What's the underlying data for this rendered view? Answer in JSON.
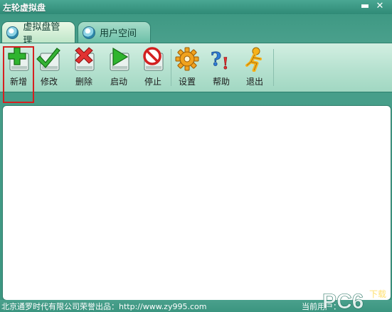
{
  "window": {
    "title": "左轮虚拟盘",
    "minimize_glyph": "▬",
    "close_glyph": "✕"
  },
  "tabs": [
    {
      "label": "虚拟盘管理",
      "icon": "disk-icon",
      "active": true
    },
    {
      "label": "用户空间",
      "icon": "disk-icon",
      "active": false
    }
  ],
  "toolbar": {
    "new_label": "新增",
    "edit_label": "修改",
    "delete_label": "删除",
    "start_label": "启动",
    "stop_label": "停止",
    "settings_label": "设置",
    "help_label": "帮助",
    "exit_label": "退出"
  },
  "status": {
    "copyright": "北京通罗时代有限公司荣誉出品：http://www.zy995.com",
    "current": "当前用户："
  },
  "watermark": {
    "text": "PC6",
    "subtext": "下载"
  },
  "colors": {
    "frame": "#3f9a86",
    "toolbar": "#b5e1cf",
    "highlight": "#d62020"
  }
}
